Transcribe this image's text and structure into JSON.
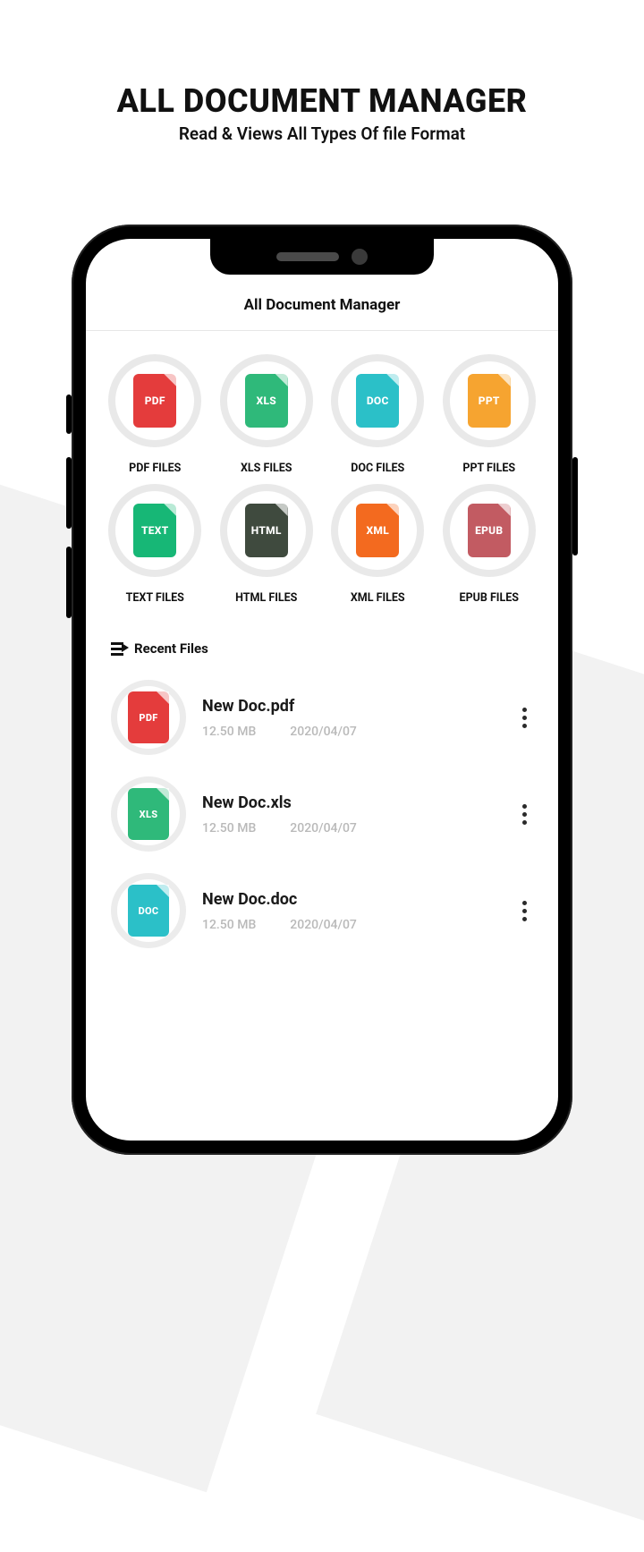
{
  "promo": {
    "title": "ALL DOCUMENT MANAGER",
    "subtitle": "Read & Views All Types Of file Format"
  },
  "app": {
    "title": "All Document Manager"
  },
  "categories": [
    {
      "badge": "PDF",
      "label": "PDF FILES",
      "color": "#E43C3C"
    },
    {
      "badge": "XLS",
      "label": "XLS FILES",
      "color": "#2FB97A"
    },
    {
      "badge": "DOC",
      "label": "DOC FILES",
      "color": "#2BC0C8"
    },
    {
      "badge": "PPT",
      "label": "PPT FILES",
      "color": "#F6A430"
    },
    {
      "badge": "TEXT",
      "label": "TEXT FILES",
      "color": "#17B776"
    },
    {
      "badge": "HTML",
      "label": "HTML FILES",
      "color": "#3F4A3E"
    },
    {
      "badge": "XML",
      "label": "XML FILES",
      "color": "#F36A1F"
    },
    {
      "badge": "EPUB",
      "label": "EPUB FILES",
      "color": "#C25B62"
    }
  ],
  "recent": {
    "heading": "Recent Files",
    "files": [
      {
        "name": "New Doc.pdf",
        "size": "12.50 MB",
        "date": "2020/04/07",
        "badge": "PDF",
        "color": "#E43C3C"
      },
      {
        "name": "New Doc.xls",
        "size": "12.50 MB",
        "date": "2020/04/07",
        "badge": "XLS",
        "color": "#2FB97A"
      },
      {
        "name": "New Doc.doc",
        "size": "12.50 MB",
        "date": "2020/04/07",
        "badge": "DOC",
        "color": "#2BC0C8"
      }
    ]
  }
}
